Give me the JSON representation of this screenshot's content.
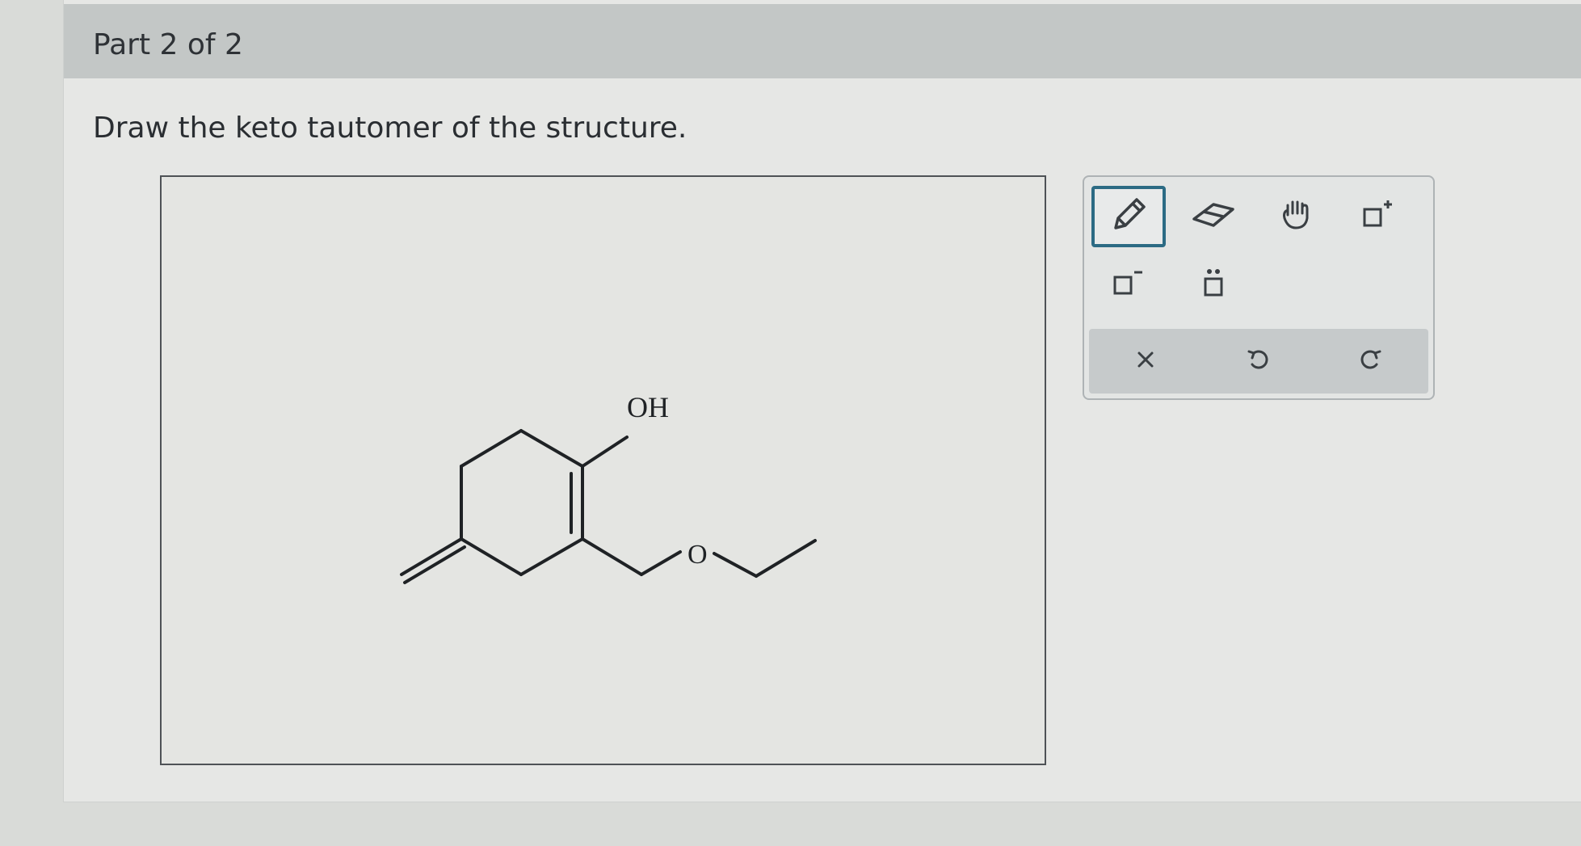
{
  "header": {
    "part_title": "Part 2 of 2"
  },
  "question": {
    "prompt": "Draw the keto tautomer of the structure."
  },
  "molecule": {
    "atom_labels": {
      "hydroxyl": "OH",
      "ether_oxygen": "O"
    }
  },
  "toolbar": {
    "tools": [
      {
        "name": "pencil-tool",
        "icon": "pencil-icon",
        "active": true
      },
      {
        "name": "eraser-tool",
        "icon": "eraser-icon",
        "active": false
      },
      {
        "name": "pan-tool",
        "icon": "hand-icon",
        "active": false
      },
      {
        "name": "positive-charge-tool",
        "icon": "box-plus-icon",
        "active": false
      },
      {
        "name": "negative-charge-tool",
        "icon": "box-minus-icon",
        "active": false
      },
      {
        "name": "lone-pair-tool",
        "icon": "box-lone-pair-icon",
        "active": false
      }
    ],
    "actions": [
      {
        "name": "clear-button",
        "icon": "close-icon"
      },
      {
        "name": "undo-button",
        "icon": "undo-icon"
      },
      {
        "name": "redo-button",
        "icon": "redo-icon"
      }
    ]
  },
  "colors": {
    "accent": "#2c6b84",
    "header_bg": "#c3c7c6",
    "action_bar_bg": "#c6cacb"
  }
}
